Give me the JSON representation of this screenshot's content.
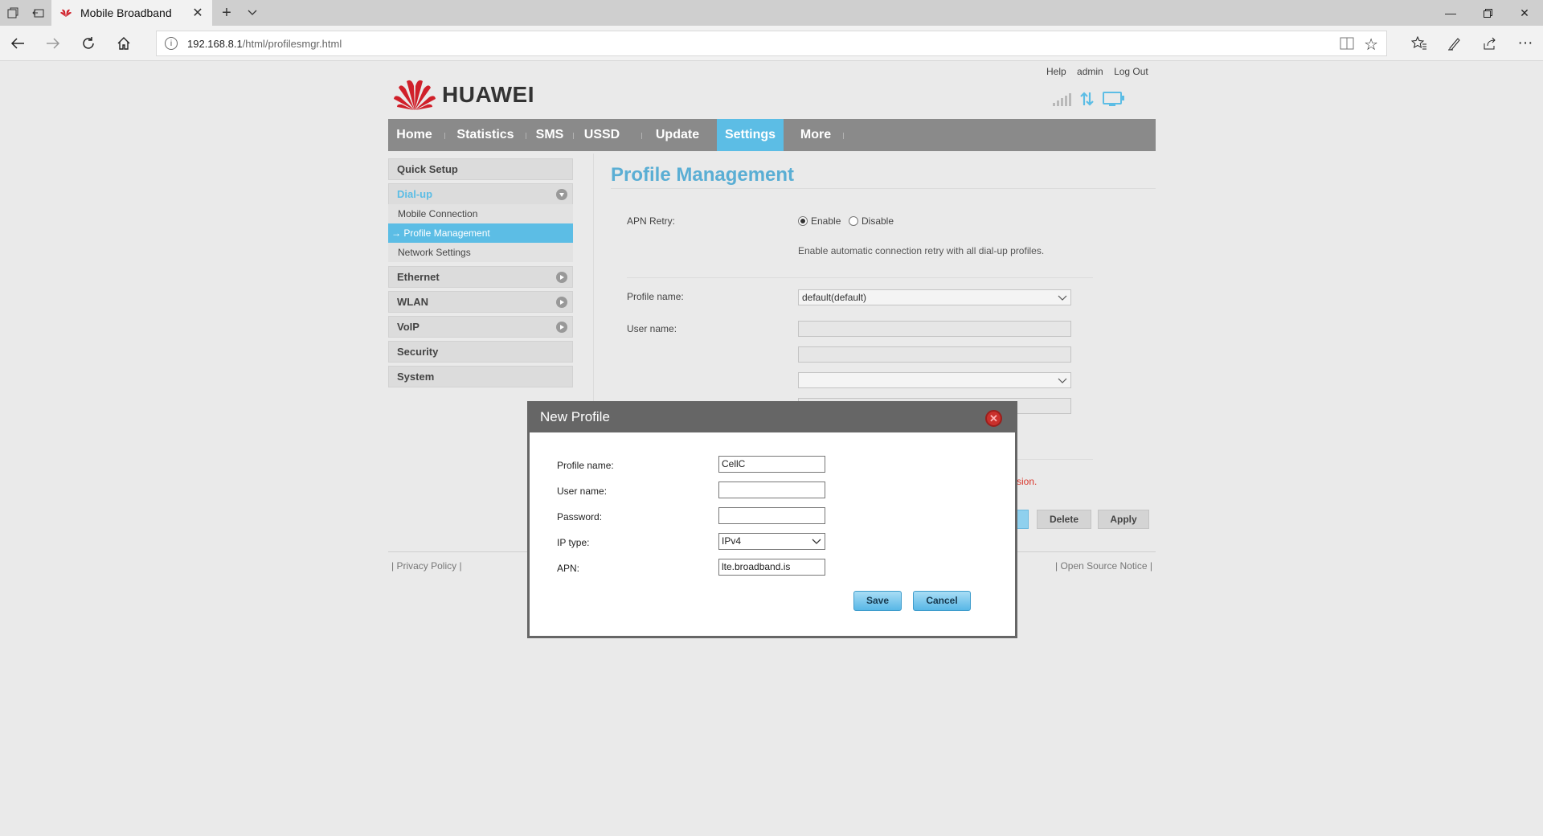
{
  "browser": {
    "tab_title": "Mobile Broadband",
    "address_host": "192.168.8.1",
    "address_path": "/html/profilesmgr.html"
  },
  "brand": {
    "name": "HUAWEI"
  },
  "top_links": [
    "Help",
    "admin",
    "Log Out"
  ],
  "nav": {
    "items": [
      "Home",
      "Statistics",
      "SMS",
      "USSD",
      "Update",
      "Settings",
      "More"
    ],
    "active": "Settings"
  },
  "sidebar": {
    "sections": [
      "Quick Setup",
      "Dial-up",
      "Ethernet",
      "WLAN",
      "VoIP",
      "Security",
      "System"
    ],
    "dialup_items": [
      "Mobile Connection",
      "Profile Management",
      "Network Settings"
    ],
    "active_item_marker": "→"
  },
  "content": {
    "title": "Profile Management",
    "apn_retry_label": "APN Retry:",
    "enable_label": "Enable",
    "disable_label": "Disable",
    "apn_retry_value": "Enable",
    "apn_retry_hint": "Enable automatic connection retry with all dial-up profiles.",
    "profile_name_label": "Profile name:",
    "profile_name_value": "default(default)",
    "user_name_label": "User name:",
    "error_fragment": "sion.",
    "delete_label": "Delete",
    "apply_label": "Apply"
  },
  "footer": {
    "privacy": "Privacy Policy",
    "open_source": "Open Source Notice"
  },
  "modal": {
    "title": "New Profile",
    "labels": {
      "profile_name": "Profile name:",
      "user_name": "User name:",
      "password": "Password:",
      "ip_type": "IP type:",
      "apn": "APN:"
    },
    "values": {
      "profile_name": "CellC",
      "user_name": "",
      "password": "",
      "ip_type": "IPv4",
      "apn": "lte.broadband.is"
    },
    "save_label": "Save",
    "cancel_label": "Cancel"
  },
  "colors": {
    "accent": "#5cbde5",
    "nav_bg": "#8a8a8a",
    "title_blue": "#5aaed4",
    "error_red": "#d9362b",
    "modal_header": "#666666"
  }
}
